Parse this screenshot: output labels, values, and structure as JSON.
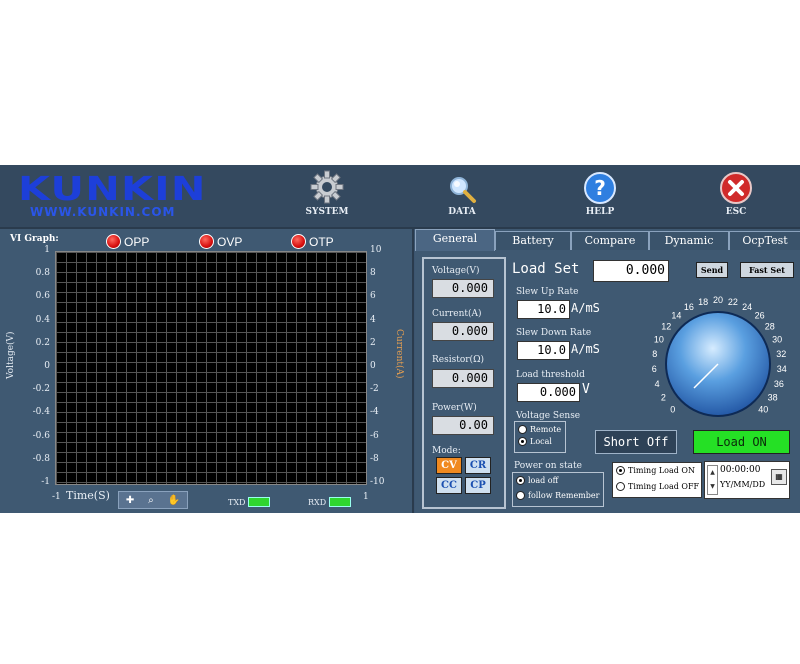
{
  "header": {
    "logo": "KUNKIN",
    "logo_url": "WWW.KUNKIN.COM",
    "tools": [
      {
        "label": "SYSTEM",
        "icon": "gear-icon"
      },
      {
        "label": "DATA",
        "icon": "magnifier-icon"
      },
      {
        "label": "HELP",
        "icon": "help-icon"
      },
      {
        "label": "ESC",
        "icon": "close-icon"
      }
    ]
  },
  "graph": {
    "title": "VI Graph:",
    "alarms": [
      "OPP",
      "OVP",
      "OTP"
    ],
    "left_axis_label": "Voltage(V)",
    "right_axis_label": "Current(A)",
    "left_ticks": [
      "1",
      "0.8",
      "0.6",
      "0.4",
      "0.2",
      "0",
      "-0.2",
      "-0.4",
      "-0.6",
      "-0.8",
      "-1"
    ],
    "right_ticks": [
      "10",
      "8",
      "6",
      "4",
      "2",
      "0",
      "-2",
      "-4",
      "-6",
      "-8",
      "-10"
    ],
    "x_label": "Time(S)",
    "x_min": "-1",
    "x_max": "1",
    "tx_label": "TXD",
    "rx_label": "RXD",
    "colors": {
      "plot_bg": "#000000",
      "grid": "#555555",
      "led": "#e01010",
      "txrx": "#2fd52f"
    }
  },
  "tabs": [
    "General",
    "Battery",
    "Compare",
    "Dynamic",
    "OcpTest"
  ],
  "readouts": {
    "voltage_label": "Voltage(V)",
    "voltage": "0.000",
    "current_label": "Current(A)",
    "current": "0.000",
    "resistor_label": "Resistor(Ω)",
    "resistor": "0.000",
    "power_label": "Power(W)",
    "power": "0.00",
    "mode_label": "Mode:",
    "modes": [
      "CV",
      "CR",
      "CC",
      "CP"
    ],
    "active_mode": "CV"
  },
  "load": {
    "label": "Load Set",
    "value": "0.000",
    "send": "Send",
    "fast_set": "Fast Set",
    "slew_up_label": "Slew Up Rate",
    "slew_up": "10.0",
    "slew_up_unit": "A/mS",
    "slew_down_label": "Slew Down Rate",
    "slew_down": "10.0",
    "slew_down_unit": "A/mS",
    "threshold_label": "Load threshold",
    "threshold": "0.000",
    "threshold_unit": "V"
  },
  "sense": {
    "label": "Voltage Sense",
    "options": [
      "Remote",
      "Local"
    ],
    "selected": "Local"
  },
  "power_on": {
    "label": "Power on state",
    "options": [
      "load off",
      "follow Remember"
    ],
    "selected": "load off"
  },
  "timing": {
    "options": [
      "Timing Load ON",
      "Timing Load OFF"
    ],
    "selected": "Timing Load ON",
    "time": "00:00:00",
    "date_format": "YY/MM/DD"
  },
  "buttons": {
    "short": "Short Off",
    "load": "Load ON"
  },
  "dial": {
    "labels": [
      "0",
      "2",
      "4",
      "6",
      "8",
      "10",
      "12",
      "14",
      "16",
      "18",
      "20",
      "22",
      "24",
      "26",
      "28",
      "30",
      "32",
      "34",
      "36",
      "38",
      "40"
    ],
    "value": 0
  }
}
